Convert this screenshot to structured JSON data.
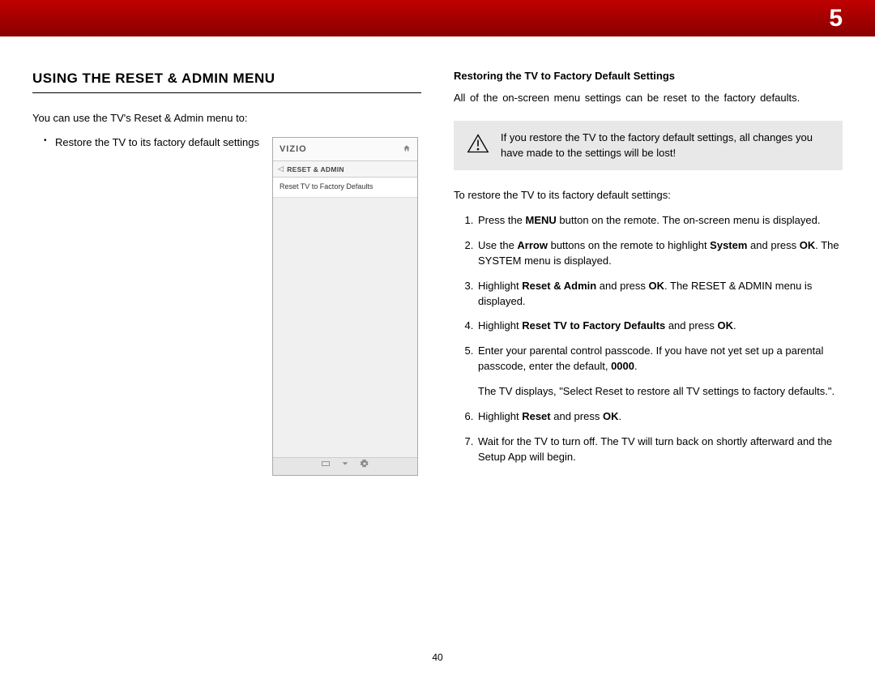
{
  "chapter_number": "5",
  "page_number": "40",
  "left": {
    "heading": "USING THE RESET & ADMIN MENU",
    "intro": "You can use the TV's Reset & Admin menu to:",
    "bullet1": "Restore the TV to its factory default settings",
    "tvmenu": {
      "logo": "VIZIO",
      "breadcrumb": "RESET & ADMIN",
      "row1": "Reset TV to Factory Defaults"
    }
  },
  "right": {
    "subhead": "Restoring the TV to Factory Default Settings",
    "para": "All of the on-screen menu settings can be reset to the factory defaults.",
    "warning": "If you restore the TV to the factory default settings, all changes you have made to the settings will be lost!",
    "lead2": "To restore the TV to its factory default settings:",
    "s1a": "Press the ",
    "s1bold1": "MENU",
    "s1b": " button on the remote. The on-screen menu is displayed.",
    "s2a": "Use the ",
    "s2bold1": "Arrow",
    "s2b": " buttons on the remote to highlight ",
    "s2bold2": "System",
    "s2c": " and press ",
    "s2bold3": "OK",
    "s2d": ". The SYSTEM menu is displayed.",
    "s3a": "Highlight ",
    "s3bold1": "Reset & Admin",
    "s3b": " and press ",
    "s3bold2": "OK",
    "s3c": ". The RESET & ADMIN menu is displayed.",
    "s4a": "Highlight ",
    "s4bold1": "Reset TV to Factory Defaults",
    "s4b": " and press ",
    "s4bold2": "OK",
    "s4c": ".",
    "s5a": "Enter your parental control passcode. If you have not yet set up a parental passcode, enter the default, ",
    "s5bold1": "0000",
    "s5b": ".",
    "s5extra": "The TV displays, \"Select Reset to restore all TV settings to factory defaults.\".",
    "s6a": "Highlight ",
    "s6bold1": "Reset",
    "s6b": " and press ",
    "s6bold2": "OK",
    "s6c": ".",
    "s7": "Wait for the TV to turn off. The TV will turn back on shortly afterward and the Setup App will begin."
  }
}
